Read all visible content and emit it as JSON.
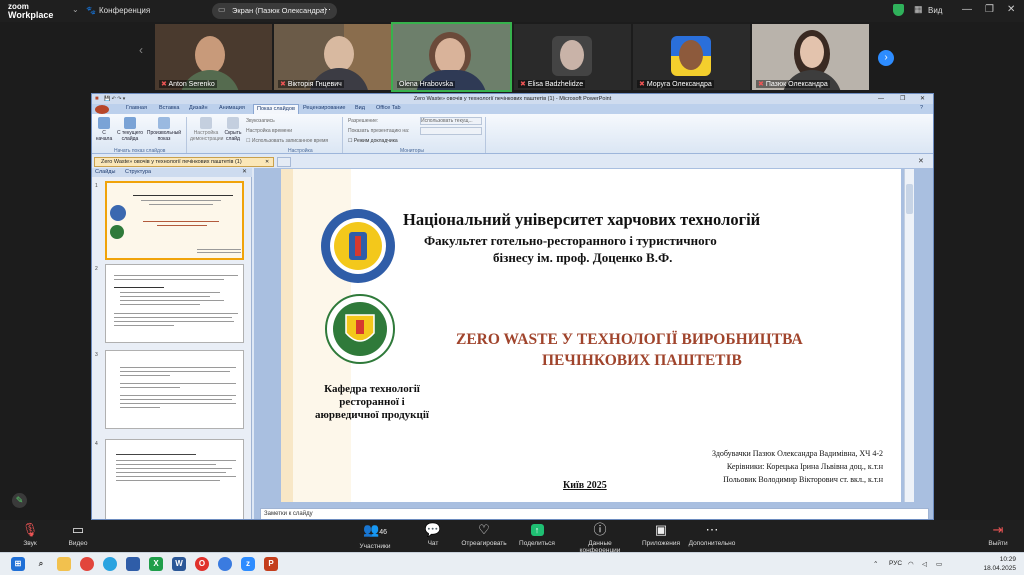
{
  "zoom": {
    "logo_line1": "zoom",
    "logo_line2": "Workplace",
    "conference_label": "Конференция",
    "screen_share_label": "Экран (Пазюк Олександра)",
    "view_label": "Вид"
  },
  "participants": [
    {
      "name": "Anton Serenko"
    },
    {
      "name": "Вікторія Гнцевич"
    },
    {
      "name": "Olena Hrabovska"
    },
    {
      "name": "Elisa Badzhelidze"
    },
    {
      "name": "Моруга Олександра"
    },
    {
      "name": "Пазюк Олександра"
    }
  ],
  "ppt": {
    "window_title": "Zero Waste» овочів у технології печінкових паштетів  (1) - Microsoft PowerPoint",
    "tabs": [
      "Главная",
      "Вставка",
      "Дизайн",
      "Анимация",
      "Показ слайдов",
      "Рецензирование",
      "Вид",
      "Office Tab"
    ],
    "active_tab": "Показ слайдов",
    "ribbon": {
      "btn_start": "С начала",
      "btn_current": "С текущего слайда",
      "btn_custom": "Произвольный показ",
      "btn_setup": "Настройка демонстрации",
      "btn_hide": "Скрыть слайд",
      "opt_record": "Звукозапись",
      "opt_rehearse": "Настройка времени",
      "opt_timing": "Использовать записанное время",
      "opt_resolution": "Разрешение:",
      "opt_resolution_value": "Использовать текущ...",
      "opt_show_on": "Показать презентацию на:",
      "opt_presenter": "Режим докладчика",
      "group_start": "Начать показ слайдов",
      "group_setup": "Настройка",
      "group_monitors": "Мониторы"
    },
    "document_tab": "Zero Waste» овочів у технології печінкових паштетів  (1)",
    "panel_tabs": [
      "Слайды",
      "Структура"
    ],
    "notes_placeholder": "Заметки к слайду"
  },
  "slide": {
    "university": "Національний університет харчових технологій",
    "faculty": "Факультет готельно-ресторанного і туристичного",
    "business": "бізнесу ім. проф. Доценко В.Ф.",
    "title_line1": "ZERO WASTE У ТЕХНОЛОГІЇ ВИРОБНИЦТВА",
    "title_line2": "ПЕЧІНКОВИХ ПАШТЕТІВ",
    "dept_line1": "Кафедра технології",
    "dept_line2": "ресторанної і",
    "dept_line3": "аюрведичної продукції",
    "author": "Здобувачки Пазюк Олександра Вадимівна, ХЧ 4-2",
    "supervisor1": "Керівники: Корецька Ірина Львівна доц., к.т.н",
    "supervisor2": "Польовик Володимир Вікторович ст. вкл., к.т.н",
    "city_year": "Київ 2025"
  },
  "toolbar": {
    "audio": "Звук",
    "video": "Видео",
    "participants": "Участники",
    "participants_count": "46",
    "chat": "Чат",
    "react": "Отреагировать",
    "share": "Поделиться",
    "meeting_data": "Данные конференции",
    "apps": "Приложения",
    "more": "Дополнительно",
    "leave": "Выйти"
  },
  "taskbar": {
    "lang": "РУС",
    "time": "10:29",
    "date": "18.04.2025"
  },
  "colors": {
    "zoom_bg": "#1f1f1f",
    "active_speaker": "#37b24d",
    "slide_title": "#a0442c",
    "share_green": "#1fbf73"
  }
}
